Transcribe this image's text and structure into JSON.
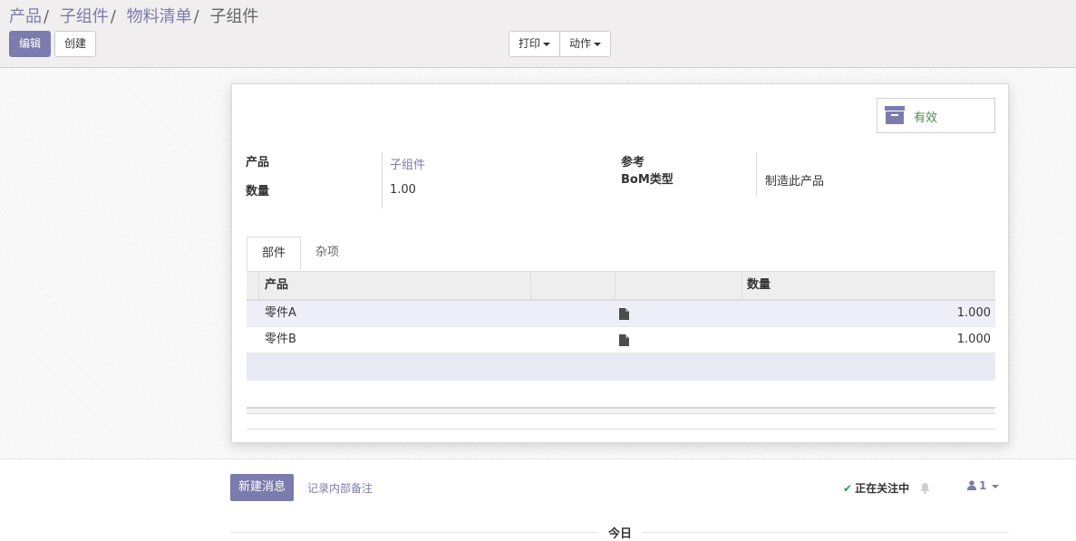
{
  "breadcrumb": {
    "items": [
      "产品",
      "子组件",
      "物料清单"
    ],
    "separator": "/",
    "current": "子组件"
  },
  "toolbar": {
    "edit_label": "编辑",
    "create_label": "创建",
    "print_label": "打印",
    "action_label": "动作"
  },
  "status": {
    "label": "有效",
    "icon": "archive-icon"
  },
  "form": {
    "product_label": "产品",
    "product_value": "子组件",
    "quantity_label": "数量",
    "quantity_value": "1.00",
    "reference_label": "参考",
    "reference_value": "",
    "bom_type_label": "BoM类型",
    "bom_type_value": "制造此产品"
  },
  "tabs": [
    {
      "label": "部件",
      "active": true
    },
    {
      "label": "杂项",
      "active": false
    }
  ],
  "components_table": {
    "columns": [
      "产品",
      "",
      "数量"
    ],
    "rows": [
      {
        "product": "零件A",
        "icon": "document-icon",
        "quantity": "1.000"
      },
      {
        "product": "零件B",
        "icon": "document-icon",
        "quantity": "1.000"
      }
    ]
  },
  "chatter": {
    "new_message_label": "新建消息",
    "log_note_label": "记录内部备注",
    "following_label": "正在关注中",
    "followers_count": "1",
    "today_label": "今日"
  },
  "colors": {
    "brand": "#7c7bad",
    "status_green": "#4d8c4d",
    "check_green": "#28a745"
  }
}
